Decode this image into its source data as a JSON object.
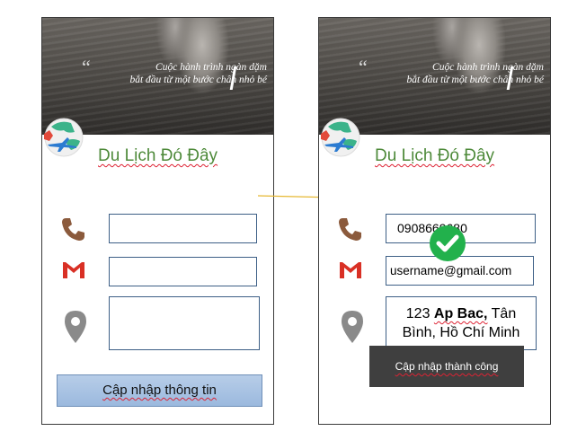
{
  "quote": {
    "line1": "Cuộc hành trình ngàn dặm",
    "line2": "bắt đầu từ một bước chân nhỏ bé"
  },
  "app": {
    "title": "Du Lịch Đó Đây"
  },
  "left_form": {
    "phone_value": "",
    "email_value": "",
    "address_value": "",
    "update_button": "Cập nhập thông tin"
  },
  "right_form": {
    "phone_value": "0908669680",
    "email_value": "username@gmail.com",
    "address_part1": "123 ",
    "address_bold": "Ap Bac,",
    "address_part2": " Tân",
    "address_line2": "Bình, Hồ Chí Minh",
    "toast_message": "Cập nhập thành công"
  },
  "colors": {
    "brand_green": "#4e8a3a",
    "phone_icon": "#8b5a3c",
    "gmail_red": "#d93025",
    "location_gray": "#8a8a8a",
    "check_green": "#22b14c",
    "arrow_yellow": "#e6b832",
    "toast_bg": "#3f3f3f"
  },
  "icons": [
    "phone-icon",
    "gmail-icon",
    "location-pin-icon",
    "travel-logo-icon",
    "checkmark-icon",
    "arrow-right-icon"
  ]
}
